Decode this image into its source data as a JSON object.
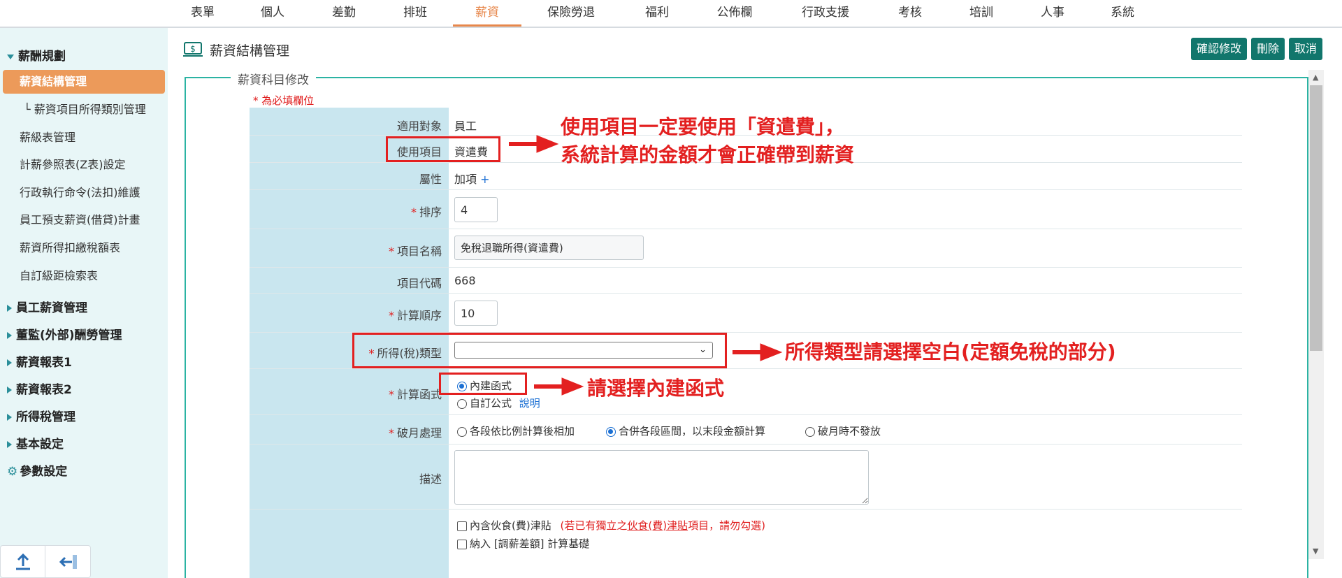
{
  "topnav": {
    "items": [
      "表單",
      "個人",
      "差勤",
      "排班",
      "薪資",
      "保險勞退",
      "福利",
      "公佈欄",
      "行政支援",
      "考核",
      "培訓",
      "人事",
      "系統"
    ],
    "active": "薪資"
  },
  "sidebar": {
    "group_main": "薪酬規劃",
    "items": [
      "薪資結構管理",
      "└ 薪資項目所得類別管理",
      "薪級表管理",
      "計薪參照表(Z表)設定",
      "行政執行命令(法扣)維護",
      "員工預支薪資(借貸)計畫",
      "薪資所得扣繳稅額表",
      "自訂級距檢索表"
    ],
    "groups": [
      "員工薪資管理",
      "董監(外部)酬勞管理",
      "薪資報表1",
      "薪資報表2",
      "所得稅管理",
      "基本設定"
    ],
    "settings": "參數設定"
  },
  "header": {
    "title": "薪資結構管理",
    "confirm": "確認修改",
    "delete": "刪除",
    "cancel": "取消"
  },
  "form": {
    "legend": "薪資科目修改",
    "required_note": "* 為必填欄位",
    "applies_label": "適用對象",
    "applies_value": "員工",
    "use_item_label": "使用項目",
    "use_item_value": "資遣費",
    "attr_label": "屬性",
    "attr_value": "加項",
    "attr_plus": "+",
    "order_label": "排序",
    "order_value": "4",
    "name_label": "項目名稱",
    "name_value": "免稅退職所得(資遣費)",
    "code_label": "項目代碼",
    "code_value": "668",
    "calc_order_label": "計算順序",
    "calc_order_value": "10",
    "income_type_label": "所得(稅)類型",
    "income_type_value": "",
    "calc_func_label": "計算函式",
    "calc_func_opt1": "內建函式",
    "calc_func_opt2": "自訂公式",
    "calc_func_help": "說明",
    "partial_label": "破月處理",
    "partial_opt1": "各段依比例計算後相加",
    "partial_opt2": "合併各段區間，以末段金額計算",
    "partial_opt3": "破月時不發放",
    "desc_label": "描述",
    "check1": "內含伙食(費)津貼",
    "check1_warn_pre": "(若已有獨立之",
    "check1_warn_link": "伙食(費)津貼",
    "check1_warn_post": "項目，請勿勾選)",
    "check2": "納入 [調薪差額] 計算基礎"
  },
  "annotations": {
    "note1_line1": "使用項目一定要使用「資遣費」，",
    "note1_line2": "系統計算的金額才會正確帶到薪資",
    "note2": "所得類型請選擇空白(定額免稅的部分)",
    "note3": "請選擇內建函式",
    "color": "#e32020"
  },
  "colors": {
    "accent": "#e7874b",
    "button": "#11766c",
    "sidebar_bg": "#e8f6f7",
    "label_bg": "#c9e6ef"
  }
}
